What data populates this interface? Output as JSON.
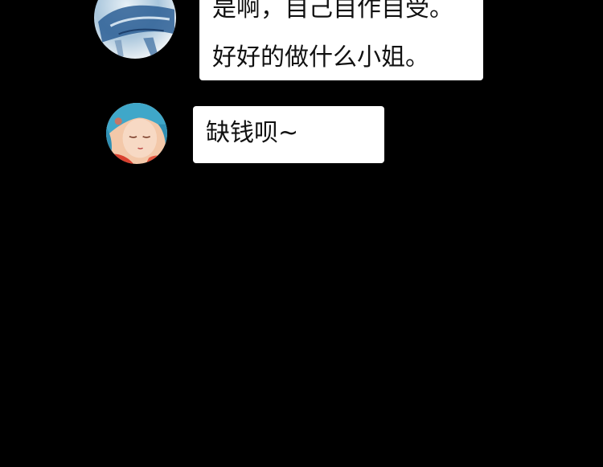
{
  "colors": {
    "background": "#000000",
    "bubble": "#ffffff",
    "text": "#111111"
  },
  "messages": [
    {
      "avatar": "whale-watercolor-avatar",
      "lines": [
        "是啊，自己自作自受。",
        "好好的做什么小姐。"
      ]
    },
    {
      "avatar": "anime-girl-avatar",
      "lines": [
        "缺钱呗~"
      ]
    }
  ]
}
